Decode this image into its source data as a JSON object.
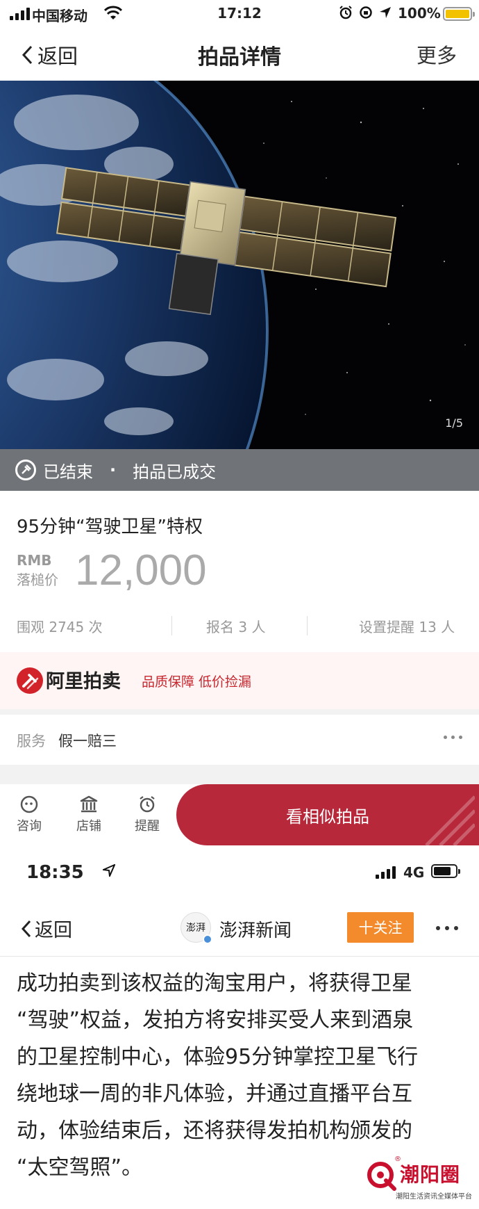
{
  "status_bar": {
    "carrier": "中国移动",
    "time": "17:12",
    "battery_pct": "100%",
    "battery_level": 1.0,
    "battery_color": "#f2c200"
  },
  "nav": {
    "back_label": "返回",
    "title": "拍品详情",
    "more_label": "更多"
  },
  "hero": {
    "image_counter": "1/5"
  },
  "status_strip": {
    "state": "已结束",
    "separator": "·",
    "result": "拍品已成交"
  },
  "lot": {
    "title": "95分钟“驾驶卫星”特权",
    "currency": "RMB",
    "price_label": "落槌价",
    "price": "12,000"
  },
  "stats": {
    "views_label": "围观",
    "views": "2745",
    "views_unit": "次",
    "signup_label": "报名",
    "signup": "3",
    "signup_unit": "人",
    "reminder_label": "设置提醒",
    "reminder": "13",
    "reminder_unit": "人"
  },
  "platform": {
    "brand": "阿里拍卖",
    "tagline": "品质保障 低价捡漏",
    "brand_color": "#d2232a"
  },
  "service": {
    "label": "服务",
    "value": "假一赔三"
  },
  "actions": {
    "consult": "咨询",
    "shop": "店铺",
    "remind": "提醒",
    "cta": "看相似拍品",
    "cta_color": "#b7283a"
  },
  "status_bar2": {
    "time": "18:35",
    "network": "4G"
  },
  "news_header": {
    "back_label": "返回",
    "avatar_text": "澎湃",
    "source_name": "澎湃新闻",
    "follow_label": "十关注",
    "follow_color": "#f38a2b"
  },
  "article": {
    "lines": [
      "成功拍卖到该权益的淘宝用户，将获得卫星",
      "“驾驶”权益，发拍方将安排买受人来到酒泉",
      "的卫星控制中心，体验95分钟掌控卫星飞行",
      "绕地球一周的非凡体验，并通过直播平台互",
      "动，体验结束后，还将获得发拍机构颁发的",
      "“太空驾照”。"
    ]
  },
  "watermark": {
    "name": "潮阳圈",
    "reg_mark": "®",
    "subtitle": "潮阳生活资讯全媒体平台"
  }
}
